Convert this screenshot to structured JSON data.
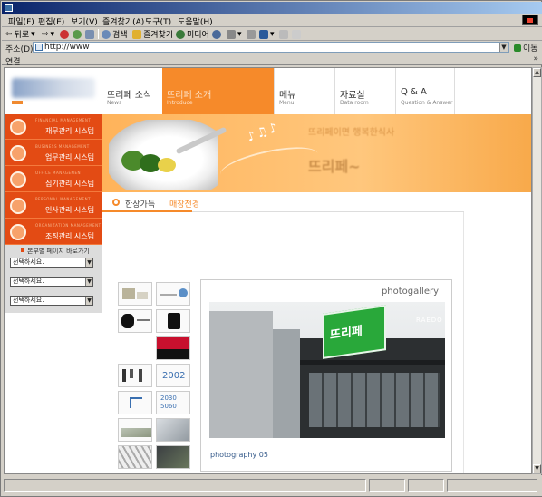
{
  "menubar": {
    "items": [
      "파일(F)",
      "편집(E)",
      "보기(V)",
      "즐겨찾기(A)",
      "도구(T)",
      "도움말(H)"
    ]
  },
  "toolbar": {
    "back": "뒤로",
    "search": "검색",
    "favorites": "즐겨찾기",
    "media": "미디어"
  },
  "addressbar": {
    "label": "주소(D)",
    "url": "http://www",
    "go": "이동"
  },
  "linksbar": {
    "label": "연결",
    "chevron": "»"
  },
  "sidebar": {
    "items": [
      {
        "sub": "FINANCIAL MANAGEMENT",
        "label": "재무관리 시스템",
        "icon": "finance-icon"
      },
      {
        "sub": "BUSINESS MANAGEMENT",
        "label": "업무관리 시스템",
        "icon": "business-icon"
      },
      {
        "sub": "OFFICE MANAGEMENT",
        "label": "집기관리 시스템",
        "icon": "office-icon"
      },
      {
        "sub": "PERSONAL MANAGEMENT",
        "label": "인사관리 시스템",
        "icon": "personnel-icon"
      },
      {
        "sub": "ORGANIZATION MANAGEMENT",
        "label": "조직관리 시스템",
        "icon": "organization-icon"
      }
    ],
    "quicknav_title": "본부별 페이지 바로가기",
    "selects": [
      "선택하세요.",
      "선택하세요.",
      "선택하세요."
    ]
  },
  "topnav": {
    "tabs": [
      {
        "ko": "뜨리페 소식",
        "en": "News"
      },
      {
        "ko": "뜨리페 소개",
        "en": "Introduce"
      },
      {
        "ko": "메뉴",
        "en": "Menu"
      },
      {
        "ko": "자료실",
        "en": "Data room"
      },
      {
        "ko": "Q & A",
        "en": "Question & Answer"
      }
    ]
  },
  "banner": {
    "notes": "♪♫♪",
    "tagline": "뜨리페이면 행복한식사",
    "tagline_big": "뜨리페~"
  },
  "breadcrumb": {
    "prefix": "한상가득",
    "current": "매장전경"
  },
  "thumbs": {
    "t2002": "2002",
    "t2030": "2030",
    "t5060": "5060"
  },
  "gallery": {
    "title": "photogallery",
    "sign_text": "뜨리페",
    "store_brand": "RAEDO",
    "caption": "photography 05"
  },
  "colors": {
    "accent": "#f68a2a",
    "sidebar": "#e34b14"
  }
}
